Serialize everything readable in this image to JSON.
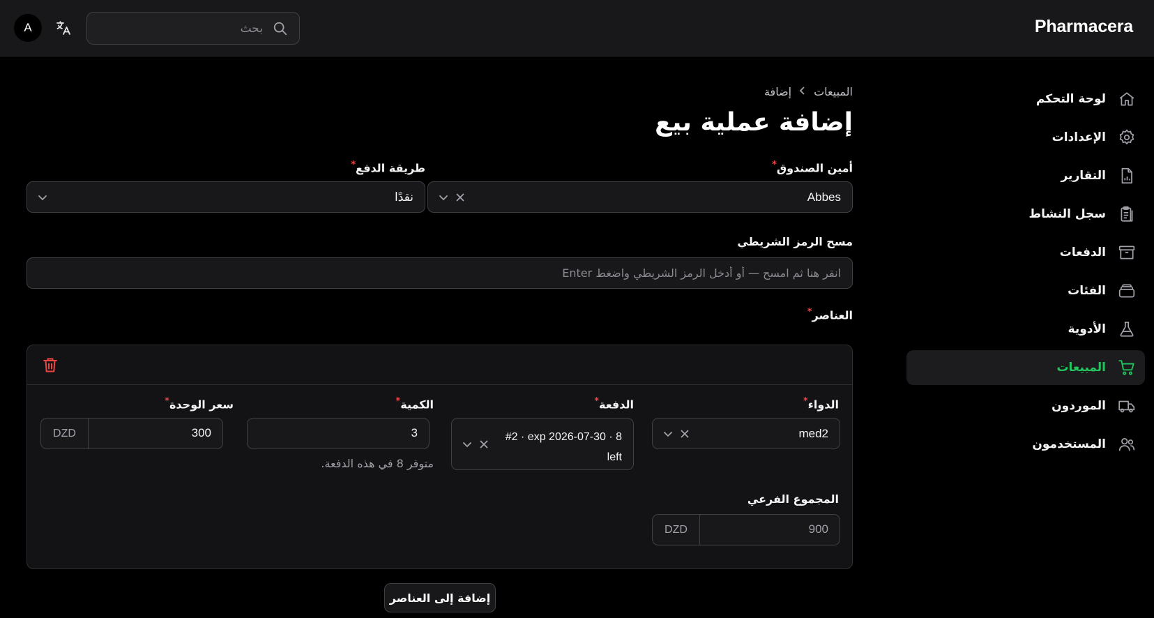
{
  "app": {
    "brand": "Pharmacera"
  },
  "header": {
    "avatar_letter": "A",
    "search": {
      "placeholder": "بحث"
    },
    "language_icon": "translate-icon"
  },
  "sidebar": {
    "items": [
      {
        "label": "لوحة التحكم",
        "icon": "home-icon",
        "active": false
      },
      {
        "label": "الإعدادات",
        "icon": "gear-icon",
        "active": false
      },
      {
        "label": "التقارير",
        "icon": "report-file-icon",
        "active": false
      },
      {
        "label": "سجل النشاط",
        "icon": "clipboard-icon",
        "active": false
      },
      {
        "label": "الدفعات",
        "icon": "archive-box-icon",
        "active": false
      },
      {
        "label": "الفئات",
        "icon": "stack-icon",
        "active": false
      },
      {
        "label": "الأدوية",
        "icon": "flask-icon",
        "active": false
      },
      {
        "label": "المبيعات",
        "icon": "cart-icon",
        "active": true
      },
      {
        "label": "الموردون",
        "icon": "truck-icon",
        "active": false
      },
      {
        "label": "المستخدمون",
        "icon": "users-icon",
        "active": false
      }
    ],
    "active_color": "#22c55e"
  },
  "breadcrumb": {
    "parent": "المبيعات",
    "current": "إضافة"
  },
  "page": {
    "title": "إضافة عملية بيع"
  },
  "form": {
    "cashier": {
      "label": "أمين الصندوق",
      "required_mark": "*",
      "value": "Abbes"
    },
    "payment_method": {
      "label": "طريقة الدفع",
      "required_mark": "*",
      "value": "نقدًا"
    },
    "barcode": {
      "label": "مسح الرمز الشريطي",
      "placeholder": "انقر هنا ثم امسح — أو أدخل الرمز الشريطي واضغط Enter"
    },
    "items": {
      "label": "العناصر",
      "required_mark": "*",
      "rows": [
        {
          "medicine": {
            "label": "الدواء",
            "required_mark": "*",
            "value": "med2"
          },
          "batch": {
            "label": "الدفعة",
            "required_mark": "*",
            "value": "#2 · exp 2026-07-30 · 8 left"
          },
          "quantity": {
            "label": "الكمية",
            "required_mark": "*",
            "value": "3",
            "hint": "متوفر 8 في هذه الدفعة."
          },
          "unit_price": {
            "label": "سعر الوحدة",
            "required_mark": "*",
            "value": "300",
            "currency": "DZD"
          },
          "subtotal": {
            "label": "المجموع الفرعي",
            "value": "900",
            "currency": "DZD"
          }
        }
      ]
    },
    "add_item_button": "إضافة إلى العناصر"
  },
  "colors": {
    "danger": "#ef4444",
    "accent": "#22c55e",
    "background": "#000000"
  }
}
